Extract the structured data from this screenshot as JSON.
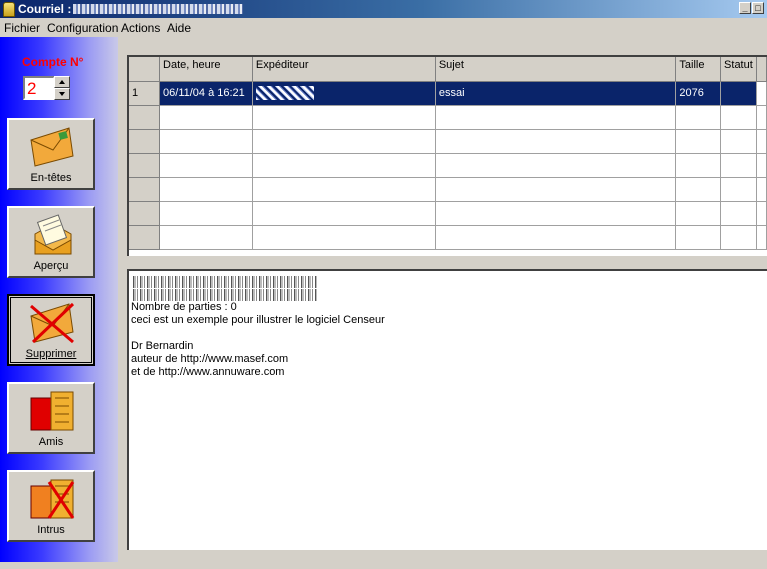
{
  "window": {
    "title": "Courriel :",
    "min_btn": "_",
    "max_btn": "□"
  },
  "menu": {
    "items": [
      "Fichier",
      "Configuration",
      "Actions",
      "Aide"
    ]
  },
  "sidebar": {
    "compte_label": "Compte N°",
    "compte_value": "2",
    "buttons": [
      {
        "label": "En-têtes",
        "icon": "envelope-icon"
      },
      {
        "label": "Aperçu",
        "icon": "open-letter-icon"
      },
      {
        "label": "Supprimer",
        "icon": "delete-envelope-icon"
      },
      {
        "label": "Amis",
        "icon": "address-book-icon"
      },
      {
        "label": "Intrus",
        "icon": "blocked-address-book-icon"
      }
    ]
  },
  "table": {
    "headers": [
      "Date, heure",
      "Expéditeur",
      "Sujet",
      "Taille",
      "Statut"
    ],
    "rows": [
      {
        "num": "1",
        "date": "06/11/04 à 16:21",
        "subject": "essai",
        "size": "2076",
        "status": ""
      }
    ]
  },
  "preview": {
    "lines": [
      "Nombre de parties : 0",
      "ceci est un exemple pour illustrer le logiciel Censeur",
      "",
      "Dr Bernardin",
      "auteur de http://www.masef.com",
      "et de http://www.annuware.com"
    ]
  },
  "colors": {
    "sidebar_blue": "#0000ff",
    "selection": "#0a246a",
    "accent_red": "#ff0000"
  }
}
